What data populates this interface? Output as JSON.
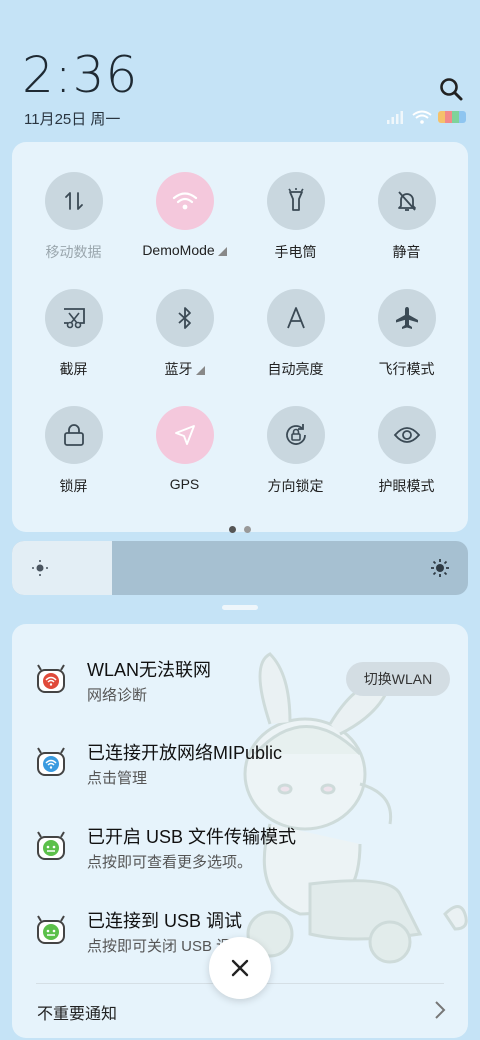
{
  "status": {
    "time": "2:36",
    "date": "11月25日 周一"
  },
  "quick_settings": {
    "tiles": [
      {
        "label": "移动数据",
        "icon": "mobile-data-icon",
        "active": false,
        "dim": true
      },
      {
        "label": "DemoMode",
        "icon": "wifi-icon",
        "active": true,
        "dim": false
      },
      {
        "label": "手电筒",
        "icon": "flashlight-icon",
        "active": false,
        "dim": false
      },
      {
        "label": "静音",
        "icon": "mute-bell-icon",
        "active": false,
        "dim": false
      },
      {
        "label": "截屏",
        "icon": "screenshot-icon",
        "active": false,
        "dim": false
      },
      {
        "label": "蓝牙",
        "icon": "bluetooth-icon",
        "active": false,
        "dim": false
      },
      {
        "label": "自动亮度",
        "icon": "auto-brightness-icon",
        "active": false,
        "dim": false
      },
      {
        "label": "飞行模式",
        "icon": "airplane-icon",
        "active": false,
        "dim": false
      },
      {
        "label": "锁屏",
        "icon": "lock-icon",
        "active": false,
        "dim": false
      },
      {
        "label": "GPS",
        "icon": "gps-icon",
        "active": true,
        "dim": false
      },
      {
        "label": "方向锁定",
        "icon": "rotation-lock-icon",
        "active": false,
        "dim": false
      },
      {
        "label": "护眼模式",
        "icon": "eye-icon",
        "active": false,
        "dim": false
      }
    ],
    "page_count": 2,
    "current_page": 1
  },
  "brightness": {
    "level": 0.22
  },
  "notifications": [
    {
      "title": "WLAN无法联网",
      "subtitle": "网络诊断",
      "action": "切换WLAN",
      "icon": "wifi-warning-icon"
    },
    {
      "title": "已连接开放网络MIPublic",
      "subtitle": "点击管理",
      "icon": "wifi-connected-icon"
    },
    {
      "title": "已开启 USB 文件传输模式",
      "subtitle": "点按即可查看更多选项。",
      "icon": "usb-android-icon"
    },
    {
      "title": "已连接到 USB 调试",
      "subtitle": "点按即可关闭 USB 调试",
      "icon": "usb-debug-android-icon"
    }
  ],
  "unimportant": {
    "label": "不重要通知"
  },
  "colors": {
    "background": "#c5e3f6",
    "panel": "#e6f3fb",
    "tile_off": "#c9d7df",
    "tile_on": "#f4c8dc"
  }
}
